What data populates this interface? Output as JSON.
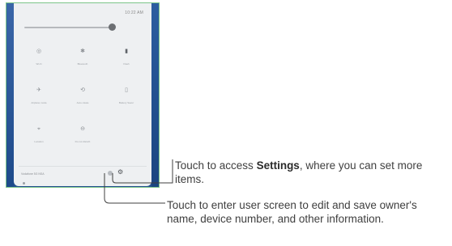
{
  "panel": {
    "clock": "10:22 AM",
    "tiles": [
      {
        "icon": "wifi-icon",
        "glyph": "◎",
        "label": "Wi-Fi"
      },
      {
        "icon": "bluetooth-icon",
        "glyph": "✱",
        "label": "Bluetooth"
      },
      {
        "icon": "flashlight-icon",
        "glyph": "▮",
        "label": "Flash"
      },
      {
        "icon": "airplane-icon",
        "glyph": "✈",
        "label": "Airplane mode"
      },
      {
        "icon": "rotate-icon",
        "glyph": "⟲",
        "label": "Auto-rotate"
      },
      {
        "icon": "battery-icon",
        "glyph": "▯",
        "label": "Battery Saver"
      },
      {
        "icon": "location-icon",
        "glyph": "⌖",
        "label": "Location"
      },
      {
        "icon": "dnd-icon",
        "glyph": "⊖",
        "label": "Do not disturb"
      }
    ],
    "footer_info": "Vodafone 5G NSA",
    "footer_user_icon": "user-icon",
    "footer_settings_icon": "gear-icon",
    "footer_settings_glyph": "⚙"
  },
  "callouts": {
    "settings": {
      "before": "Touch to access ",
      "bold": "Settings",
      "after": ", where you can set more items."
    },
    "user": {
      "text": "Touch to enter user screen to edit and save owner's name, device number, and other information."
    }
  },
  "colors": {
    "frame_border": "#7cc58a",
    "wallpaper": "#24508f",
    "panel_bg": "#eef0f2",
    "text": "#3f3f3f"
  }
}
